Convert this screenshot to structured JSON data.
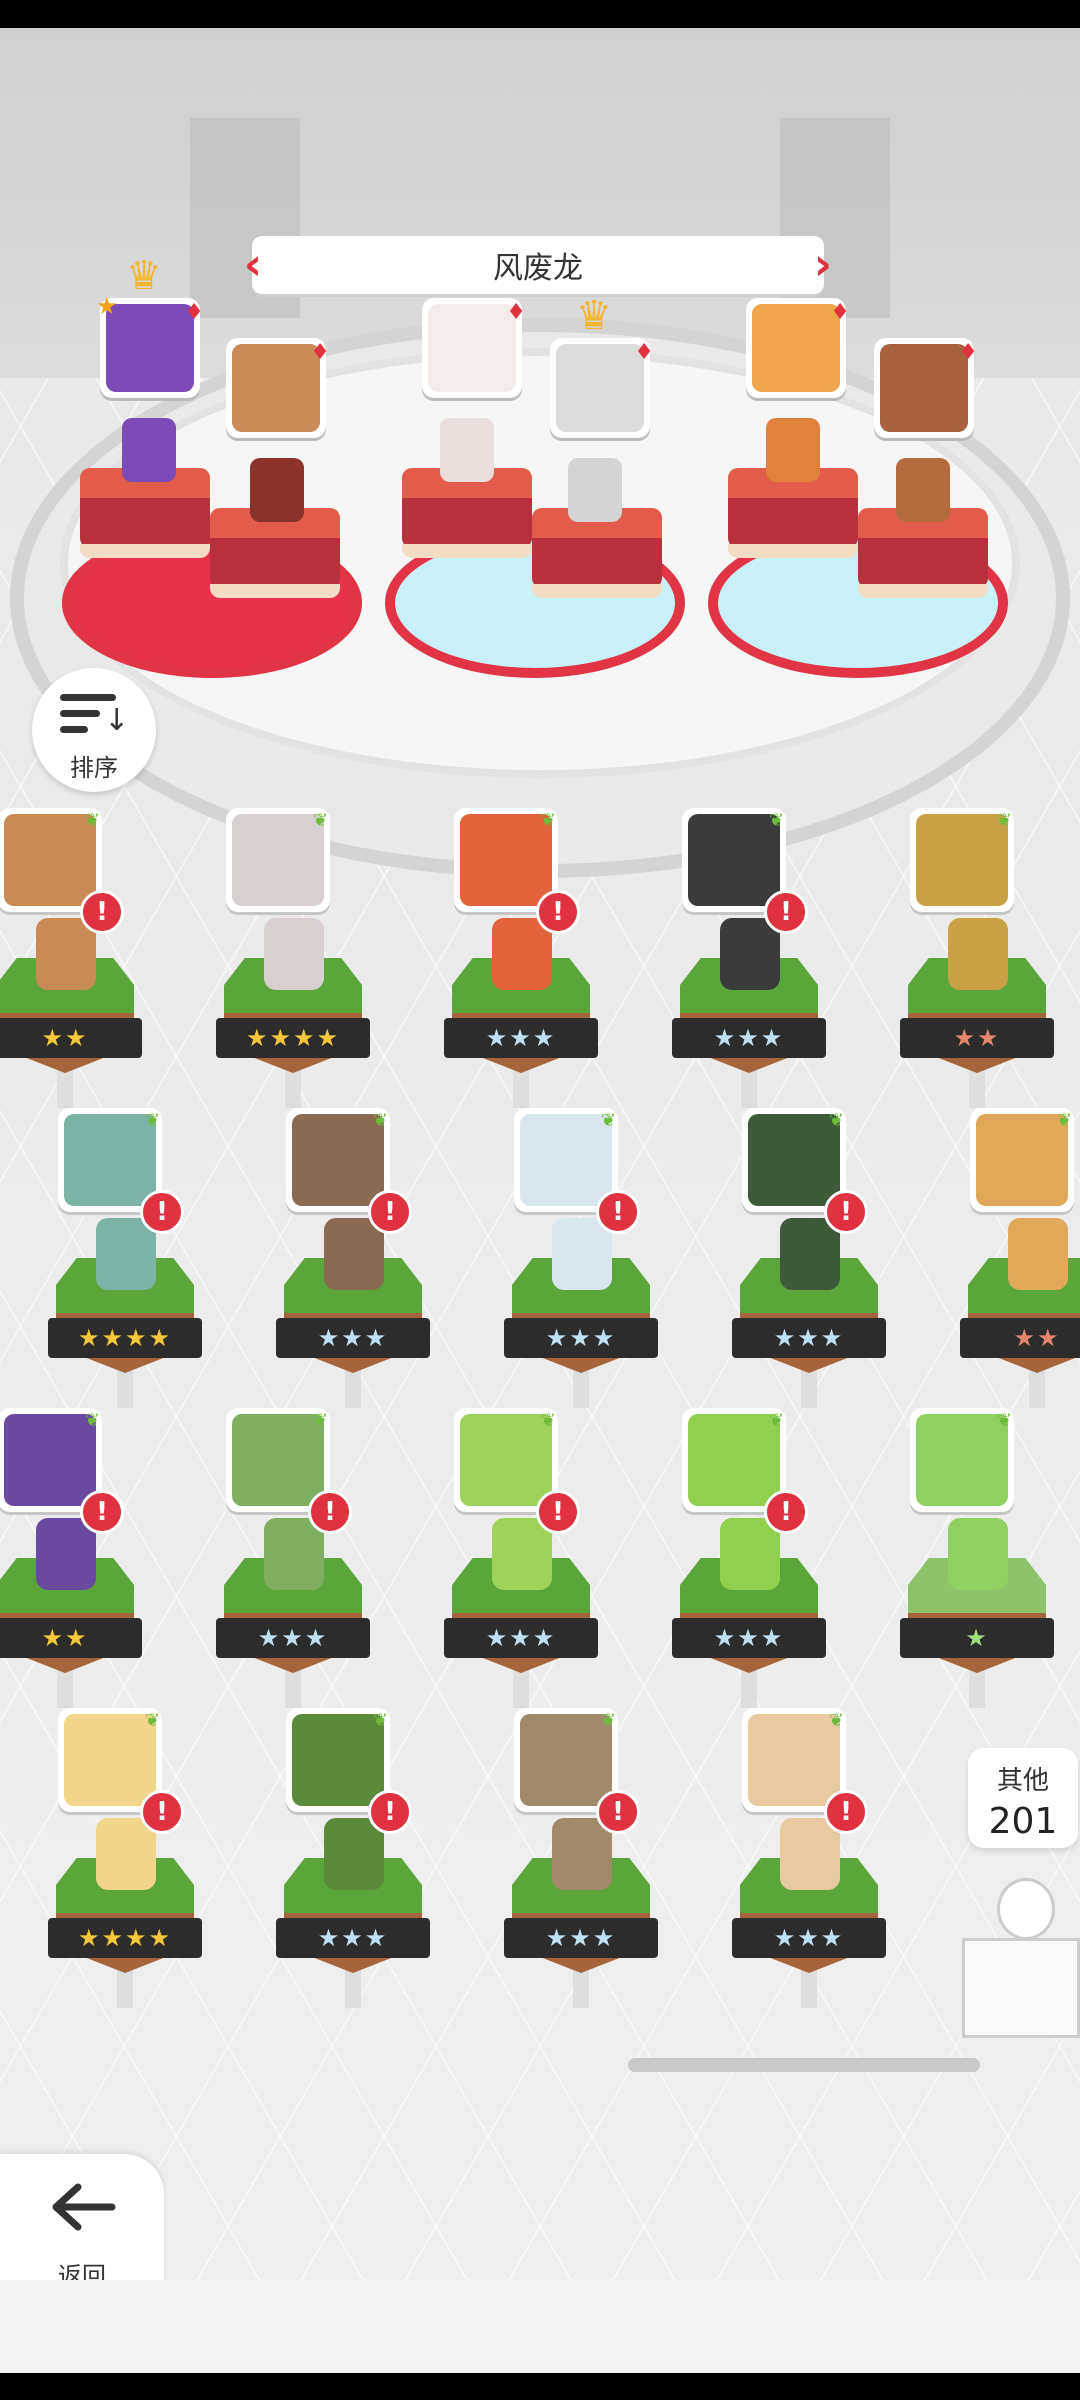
{
  "banner": {
    "title": "风废龙"
  },
  "sort_button": {
    "label": "排序"
  },
  "other_box": {
    "label": "其他",
    "count": "201"
  },
  "back_button": {
    "label": "返回"
  },
  "team": [
    {
      "slot": 1,
      "badge": "crown-star",
      "color": "#7c4bb5",
      "pad": "red"
    },
    {
      "slot": 2,
      "badge": "",
      "color": "#c98a56",
      "pad": "red"
    },
    {
      "slot": 3,
      "badge": "",
      "color": "#f3ecea",
      "pad": "cyan"
    },
    {
      "slot": 4,
      "badge": "crown",
      "color": "#dcdcdc",
      "pad": "cyan"
    },
    {
      "slot": 5,
      "badge": "",
      "color": "#f0a54b",
      "pad": "cyan"
    },
    {
      "slot": 6,
      "badge": "",
      "color": "#a9623d",
      "pad": "cyan"
    }
  ],
  "roster": [
    {
      "row": 1,
      "stars": "★★",
      "tier": "gold",
      "alert": true
    },
    {
      "row": 1,
      "stars": "★★★★",
      "tier": "gold",
      "alert": false
    },
    {
      "row": 1,
      "stars": "★★★",
      "tier": "silver",
      "alert": true
    },
    {
      "row": 1,
      "stars": "★★★",
      "tier": "silver",
      "alert": true
    },
    {
      "row": 1,
      "stars": "★★",
      "tier": "bronze",
      "alert": false
    },
    {
      "row": 2,
      "stars": "★★★★",
      "tier": "gold",
      "alert": true
    },
    {
      "row": 2,
      "stars": "★★★",
      "tier": "silver",
      "alert": true
    },
    {
      "row": 2,
      "stars": "★★★",
      "tier": "silver",
      "alert": true
    },
    {
      "row": 2,
      "stars": "★★★",
      "tier": "silver",
      "alert": true
    },
    {
      "row": 2,
      "stars": "★★",
      "tier": "bronze",
      "alert": false
    },
    {
      "row": 3,
      "stars": "★★",
      "tier": "gold",
      "alert": true
    },
    {
      "row": 3,
      "stars": "★★★",
      "tier": "silver",
      "alert": true
    },
    {
      "row": 3,
      "stars": "★★★",
      "tier": "silver",
      "alert": true
    },
    {
      "row": 3,
      "stars": "★★★",
      "tier": "silver",
      "alert": true
    },
    {
      "row": 3,
      "stars": "★",
      "tier": "green",
      "alert": false
    },
    {
      "row": 4,
      "stars": "★★★★",
      "tier": "gold",
      "alert": true
    },
    {
      "row": 4,
      "stars": "★★★",
      "tier": "silver",
      "alert": true
    },
    {
      "row": 4,
      "stars": "★★★",
      "tier": "silver",
      "alert": true
    },
    {
      "row": 4,
      "stars": "★★★",
      "tier": "silver",
      "alert": true
    }
  ],
  "icons": {
    "sort": "sort-icon",
    "back": "arrow-left-icon",
    "alert": "exclamation-icon",
    "element": "leaf-icon",
    "rarity": "diamond-icon",
    "leader": "crown-icon"
  },
  "colors": {
    "accent_red": "#e0313f",
    "grass": "#5aa63a",
    "plate": "#2c2c2c",
    "gold_star": "#f7c63a",
    "silver_star": "#bfe0f5"
  }
}
